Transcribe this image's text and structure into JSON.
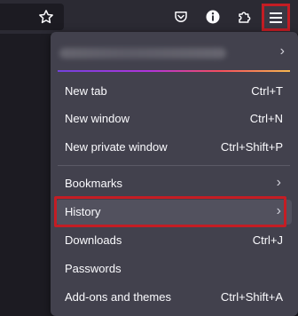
{
  "toolbar": {
    "icons": [
      "star-icon",
      "pocket-icon",
      "info-icon",
      "extensions-icon",
      "hamburger-menu-icon"
    ]
  },
  "colors": {
    "toolbar_bg": "#2b2a33",
    "panel_bg": "#42414d",
    "highlight_outline": "#c41d24",
    "text": "#fbfbfe"
  },
  "menu": {
    "account": {
      "chevron": "›"
    },
    "items": [
      {
        "label": "New tab",
        "shortcut": "Ctrl+T"
      },
      {
        "label": "New window",
        "shortcut": "Ctrl+N"
      },
      {
        "label": "New private window",
        "shortcut": "Ctrl+Shift+P"
      },
      {
        "label": "Bookmarks",
        "chevron": "›"
      },
      {
        "label": "History",
        "chevron": "›"
      },
      {
        "label": "Downloads",
        "shortcut": "Ctrl+J"
      },
      {
        "label": "Passwords"
      },
      {
        "label": "Add-ons and themes",
        "shortcut": "Ctrl+Shift+A"
      }
    ]
  }
}
